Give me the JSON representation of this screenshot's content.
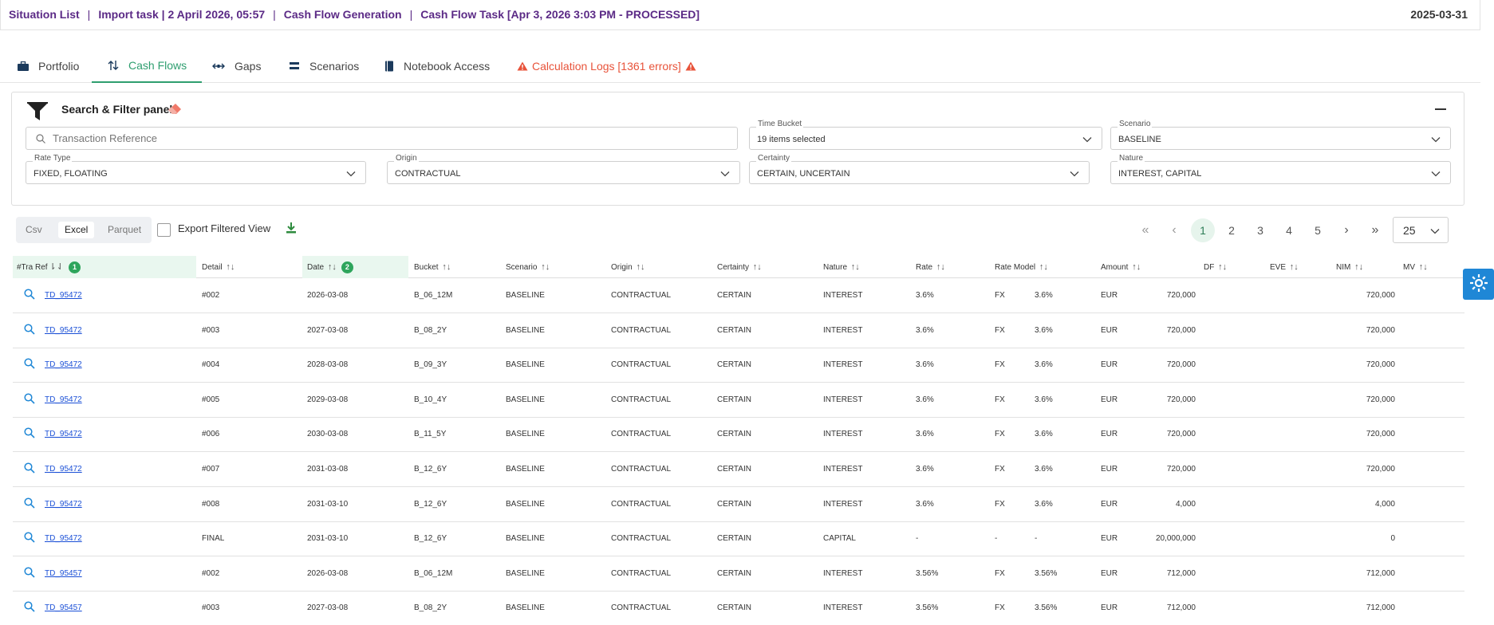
{
  "breadcrumb": {
    "items": [
      "Situation List",
      "Import task | 2 April 2026, 05:57",
      "Cash Flow Generation",
      "Cash Flow Task [Apr 3, 2026 3:03 PM - PROCESSED]"
    ],
    "separator": "|"
  },
  "header": {
    "date": "2025-03-31"
  },
  "tabs": [
    {
      "label": "Portfolio",
      "icon": "briefcase-icon"
    },
    {
      "label": "Cash Flows",
      "icon": "sort-arrows-icon",
      "active": true
    },
    {
      "label": "Gaps",
      "icon": "horizontal-arrows-icon"
    },
    {
      "label": "Scenarios",
      "icon": "layers-icon"
    },
    {
      "label": "Notebook Access",
      "icon": "notebook-icon"
    },
    {
      "label": "Calculation Logs [1361 errors]",
      "icon": "warning-icon",
      "warn": true
    }
  ],
  "filter_panel": {
    "title": "Search & Filter panel",
    "search_placeholder": "Transaction Reference",
    "time_bucket": {
      "label": "Time Bucket",
      "value": "19 items selected"
    },
    "scenario": {
      "label": "Scenario",
      "value": "BASELINE"
    },
    "rate_type": {
      "label": "Rate Type",
      "value": "FIXED, FLOATING"
    },
    "origin": {
      "label": "Origin",
      "value": "CONTRACTUAL"
    },
    "certainty": {
      "label": "Certainty",
      "value": "CERTAIN, UNCERTAIN"
    },
    "nature": {
      "label": "Nature",
      "value": "INTEREST, CAPITAL"
    }
  },
  "export": {
    "formats": [
      "Csv",
      "Excel",
      "Parquet"
    ],
    "selected": "Excel",
    "filtered_label": "Export Filtered View"
  },
  "pagination": {
    "first": "«",
    "prev": "‹",
    "next": "›",
    "last": "»",
    "pages": [
      "1",
      "2",
      "3",
      "4",
      "5"
    ],
    "current": "1",
    "page_size": "25"
  },
  "table": {
    "headers": {
      "ref": "#Tra Ref",
      "ref_badge": "1",
      "detail": "Detail",
      "date": "Date",
      "date_badge": "2",
      "bucket": "Bucket",
      "scenario": "Scenario",
      "origin": "Origin",
      "certainty": "Certainty",
      "nature": "Nature",
      "rate": "Rate",
      "rate_model": "Rate Model",
      "amount": "Amount",
      "df": "DF",
      "eve": "EVE",
      "nim": "NIM",
      "mv": "MV"
    },
    "rows": [
      {
        "ref": "TD_95472",
        "detail": "#002",
        "date": "2026-03-08",
        "bucket": "B_06_12M",
        "scenario": "BASELINE",
        "origin": "CONTRACTUAL",
        "certainty": "CERTAIN",
        "nature": "INTEREST",
        "rate": "3.6%",
        "rm_type": "FX",
        "rm_rate": "3.6%",
        "ccy": "EUR",
        "amount": "720,000",
        "nim": "720,000"
      },
      {
        "ref": "TD_95472",
        "detail": "#003",
        "date": "2027-03-08",
        "bucket": "B_08_2Y",
        "scenario": "BASELINE",
        "origin": "CONTRACTUAL",
        "certainty": "CERTAIN",
        "nature": "INTEREST",
        "rate": "3.6%",
        "rm_type": "FX",
        "rm_rate": "3.6%",
        "ccy": "EUR",
        "amount": "720,000",
        "nim": "720,000"
      },
      {
        "ref": "TD_95472",
        "detail": "#004",
        "date": "2028-03-08",
        "bucket": "B_09_3Y",
        "scenario": "BASELINE",
        "origin": "CONTRACTUAL",
        "certainty": "CERTAIN",
        "nature": "INTEREST",
        "rate": "3.6%",
        "rm_type": "FX",
        "rm_rate": "3.6%",
        "ccy": "EUR",
        "amount": "720,000",
        "nim": "720,000"
      },
      {
        "ref": "TD_95472",
        "detail": "#005",
        "date": "2029-03-08",
        "bucket": "B_10_4Y",
        "scenario": "BASELINE",
        "origin": "CONTRACTUAL",
        "certainty": "CERTAIN",
        "nature": "INTEREST",
        "rate": "3.6%",
        "rm_type": "FX",
        "rm_rate": "3.6%",
        "ccy": "EUR",
        "amount": "720,000",
        "nim": "720,000"
      },
      {
        "ref": "TD_95472",
        "detail": "#006",
        "date": "2030-03-08",
        "bucket": "B_11_5Y",
        "scenario": "BASELINE",
        "origin": "CONTRACTUAL",
        "certainty": "CERTAIN",
        "nature": "INTEREST",
        "rate": "3.6%",
        "rm_type": "FX",
        "rm_rate": "3.6%",
        "ccy": "EUR",
        "amount": "720,000",
        "nim": "720,000"
      },
      {
        "ref": "TD_95472",
        "detail": "#007",
        "date": "2031-03-08",
        "bucket": "B_12_6Y",
        "scenario": "BASELINE",
        "origin": "CONTRACTUAL",
        "certainty": "CERTAIN",
        "nature": "INTEREST",
        "rate": "3.6%",
        "rm_type": "FX",
        "rm_rate": "3.6%",
        "ccy": "EUR",
        "amount": "720,000",
        "nim": "720,000"
      },
      {
        "ref": "TD_95472",
        "detail": "#008",
        "date": "2031-03-10",
        "bucket": "B_12_6Y",
        "scenario": "BASELINE",
        "origin": "CONTRACTUAL",
        "certainty": "CERTAIN",
        "nature": "INTEREST",
        "rate": "3.6%",
        "rm_type": "FX",
        "rm_rate": "3.6%",
        "ccy": "EUR",
        "amount": "4,000",
        "nim": "4,000"
      },
      {
        "ref": "TD_95472",
        "detail": "FINAL",
        "date": "2031-03-10",
        "bucket": "B_12_6Y",
        "scenario": "BASELINE",
        "origin": "CONTRACTUAL",
        "certainty": "CERTAIN",
        "nature": "CAPITAL",
        "rate": "-",
        "rm_type": "-",
        "rm_rate": "-",
        "ccy": "EUR",
        "amount": "20,000,000",
        "nim": "0"
      },
      {
        "ref": "TD_95457",
        "detail": "#002",
        "date": "2026-03-08",
        "bucket": "B_06_12M",
        "scenario": "BASELINE",
        "origin": "CONTRACTUAL",
        "certainty": "CERTAIN",
        "nature": "INTEREST",
        "rate": "3.56%",
        "rm_type": "FX",
        "rm_rate": "3.56%",
        "ccy": "EUR",
        "amount": "712,000",
        "nim": "712,000"
      },
      {
        "ref": "TD_95457",
        "detail": "#003",
        "date": "2027-03-08",
        "bucket": "B_08_2Y",
        "scenario": "BASELINE",
        "origin": "CONTRACTUAL",
        "certainty": "CERTAIN",
        "nature": "INTEREST",
        "rate": "3.56%",
        "rm_type": "FX",
        "rm_rate": "3.56%",
        "ccy": "EUR",
        "amount": "712,000",
        "nim": "712,000"
      }
    ]
  },
  "colors": {
    "accent": "#2e9e6f",
    "warn": "#e8533a",
    "breadcrumb": "#5b2a86",
    "link": "#1a4fd6",
    "gear": "#1f87d6"
  }
}
